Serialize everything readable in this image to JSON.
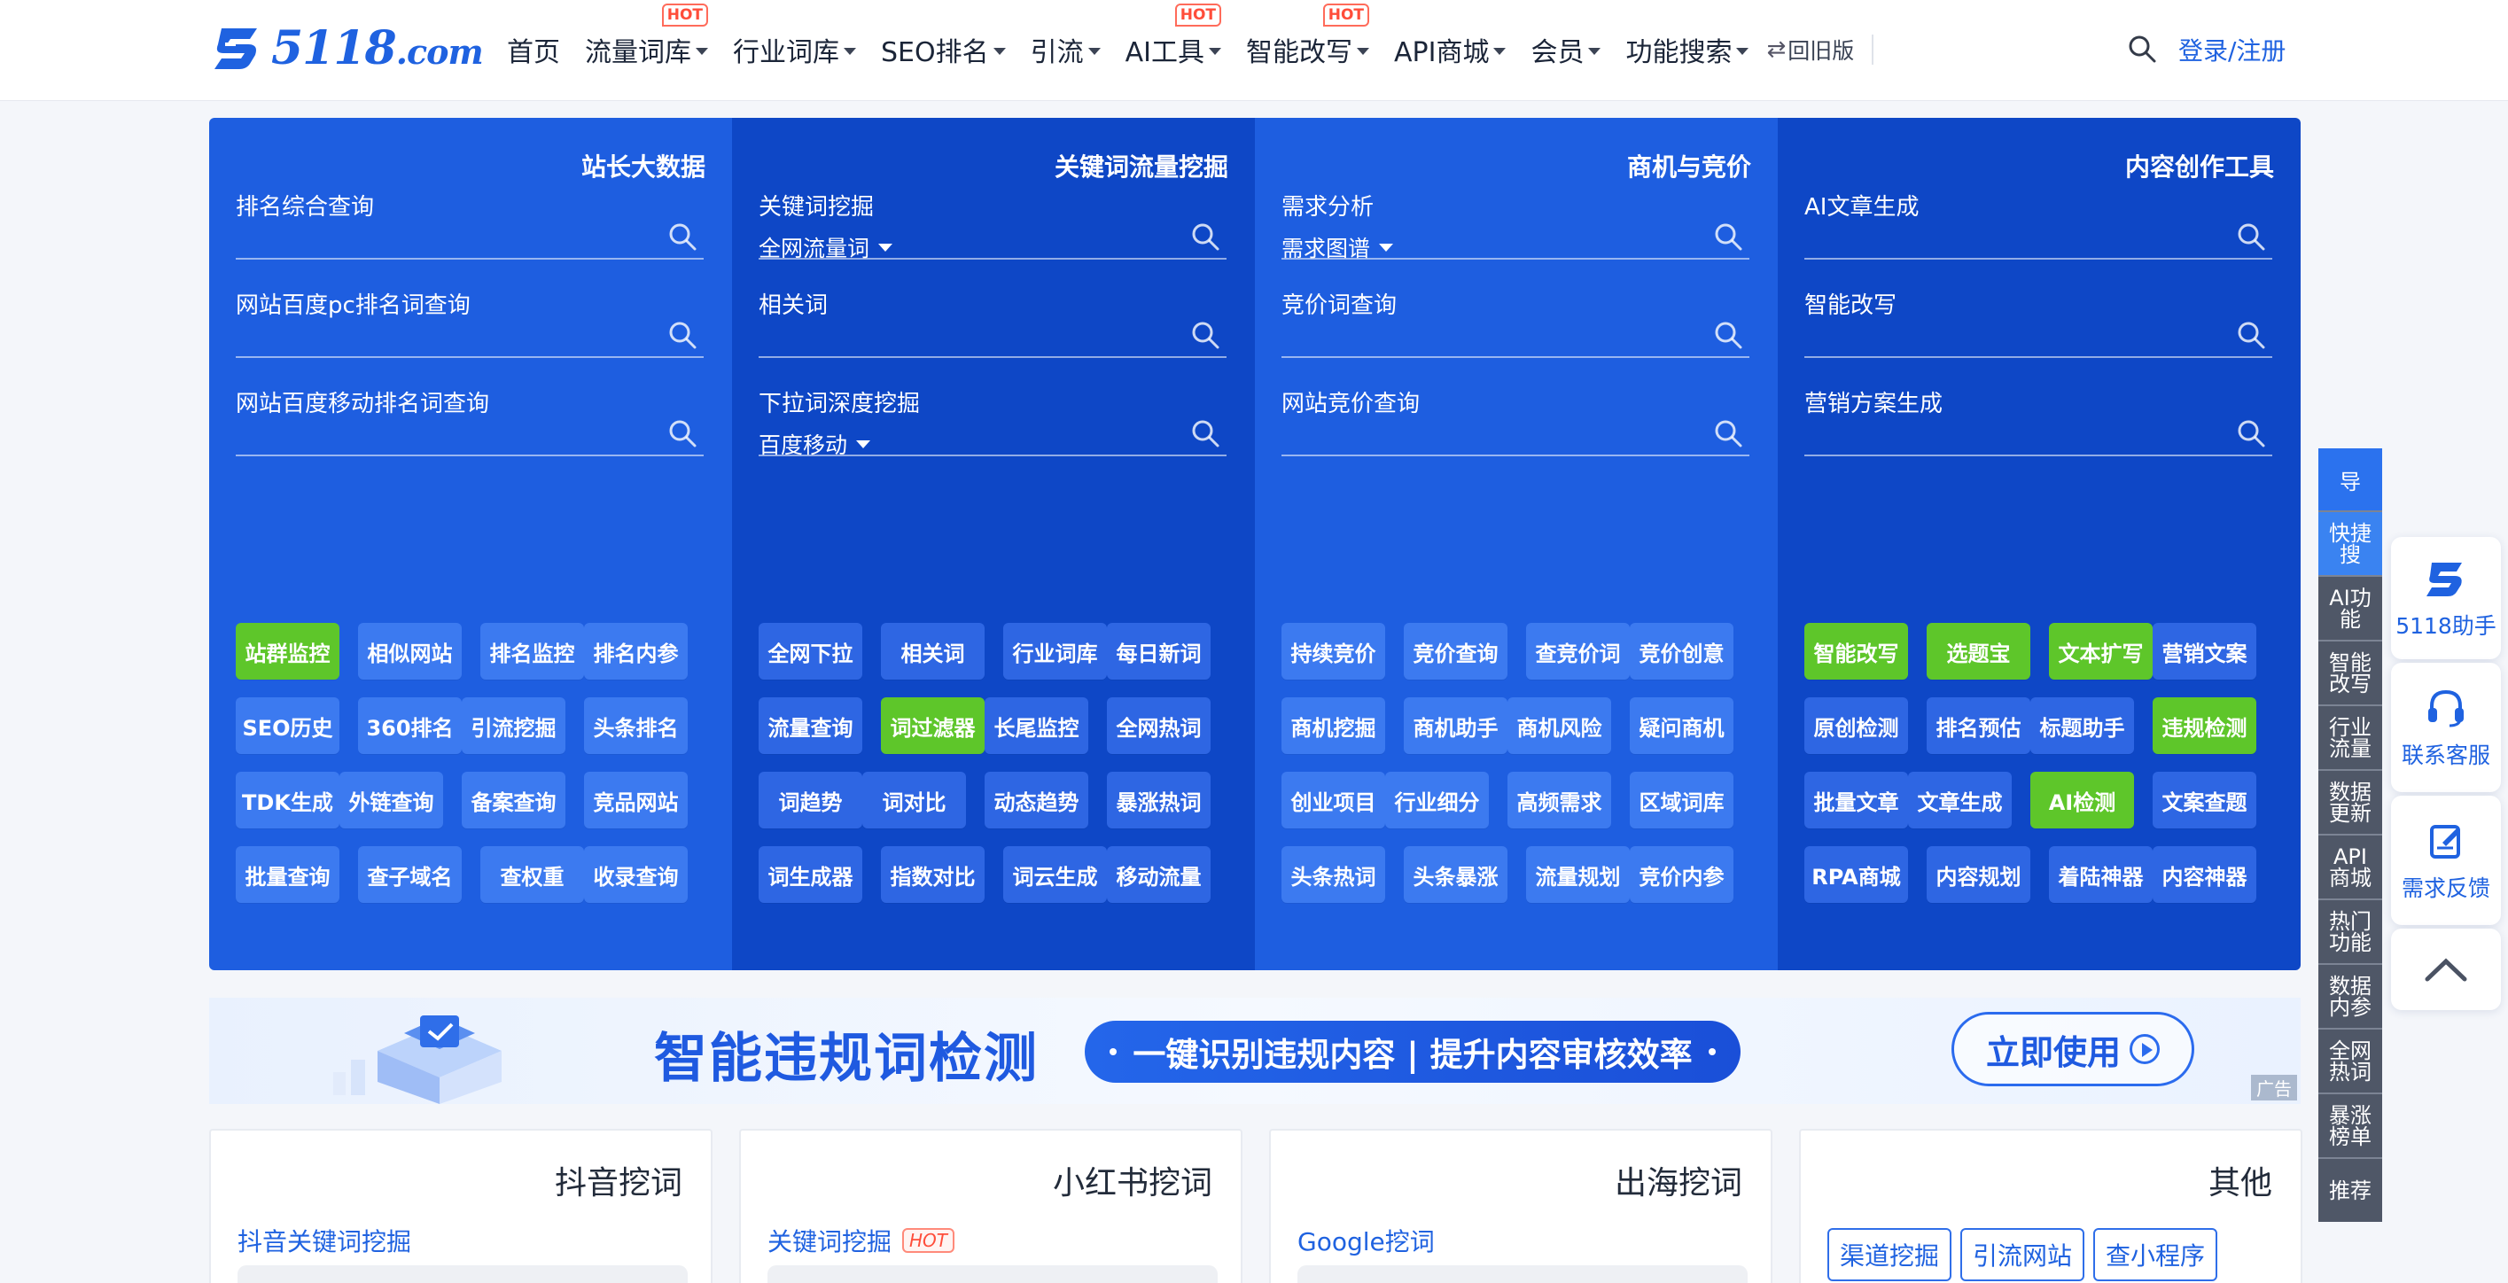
{
  "header": {
    "logo_text": "5118",
    "logo_suffix": ".com",
    "nav": [
      {
        "label": "首页",
        "dropdown": false,
        "hot": ""
      },
      {
        "label": "流量词库",
        "dropdown": true,
        "hot": "HOT"
      },
      {
        "label": "行业词库",
        "dropdown": true,
        "hot": ""
      },
      {
        "label": "SEO排名",
        "dropdown": true,
        "hot": ""
      },
      {
        "label": "引流",
        "dropdown": true,
        "hot": ""
      },
      {
        "label": "AI工具",
        "dropdown": true,
        "hot": "HOT"
      },
      {
        "label": "智能改写",
        "dropdown": true,
        "hot": "HOT"
      },
      {
        "label": "API商城",
        "dropdown": true,
        "hot": ""
      },
      {
        "label": "会员",
        "dropdown": true,
        "hot": ""
      },
      {
        "label": "功能搜索",
        "dropdown": true,
        "hot": ""
      }
    ],
    "old_version": "回旧版",
    "login": "登录/注册"
  },
  "panel": {
    "columns": [
      {
        "title": "站长大数据",
        "queries": [
          {
            "label": "排名综合查询",
            "sub": ""
          },
          {
            "label": "网站百度pc排名词查询",
            "sub": ""
          },
          {
            "label": "网站百度移动排名词查询",
            "sub": ""
          }
        ],
        "buttons": [
          {
            "label": "站群监控",
            "green": true
          },
          {
            "label": "相似网站",
            "green": false
          },
          {
            "label": "排名监控",
            "green": false
          },
          {
            "label": "排名内参",
            "green": false
          },
          {
            "label": "SEO历史",
            "green": false
          },
          {
            "label": "360排名",
            "green": false
          },
          {
            "label": "引流挖掘",
            "green": false
          },
          {
            "label": "头条排名",
            "green": false
          },
          {
            "label": "TDK生成",
            "green": false
          },
          {
            "label": "外链查询",
            "green": false
          },
          {
            "label": "备案查询",
            "green": false
          },
          {
            "label": "竞品网站",
            "green": false
          },
          {
            "label": "批量查询",
            "green": false
          },
          {
            "label": "查子域名",
            "green": false
          },
          {
            "label": "查权重",
            "green": false
          },
          {
            "label": "收录查询",
            "green": false
          }
        ]
      },
      {
        "title": "关键词流量挖掘",
        "queries": [
          {
            "label": "关键词挖掘",
            "sub": "全网流量词"
          },
          {
            "label": "相关词",
            "sub": ""
          },
          {
            "label": "下拉词深度挖掘",
            "sub": "百度移动"
          }
        ],
        "buttons": [
          {
            "label": "全网下拉",
            "green": false
          },
          {
            "label": "相关词",
            "green": false
          },
          {
            "label": "行业词库",
            "green": false
          },
          {
            "label": "每日新词",
            "green": false
          },
          {
            "label": "流量查询",
            "green": false
          },
          {
            "label": "词过滤器",
            "green": true
          },
          {
            "label": "长尾监控",
            "green": false
          },
          {
            "label": "全网热词",
            "green": false
          },
          {
            "label": "词趋势",
            "green": false
          },
          {
            "label": "词对比",
            "green": false
          },
          {
            "label": "动态趋势",
            "green": false
          },
          {
            "label": "暴涨热词",
            "green": false
          },
          {
            "label": "词生成器",
            "green": false
          },
          {
            "label": "指数对比",
            "green": false
          },
          {
            "label": "词云生成",
            "green": false
          },
          {
            "label": "移动流量",
            "green": false
          }
        ]
      },
      {
        "title": "商机与竞价",
        "queries": [
          {
            "label": "需求分析",
            "sub": "需求图谱"
          },
          {
            "label": "竞价词查询",
            "sub": ""
          },
          {
            "label": "网站竞价查询",
            "sub": ""
          }
        ],
        "buttons": [
          {
            "label": "持续竞价",
            "green": false
          },
          {
            "label": "竞价查询",
            "green": false
          },
          {
            "label": "查竞价词",
            "green": false
          },
          {
            "label": "竞价创意",
            "green": false
          },
          {
            "label": "商机挖掘",
            "green": false
          },
          {
            "label": "商机助手",
            "green": false
          },
          {
            "label": "商机风险",
            "green": false
          },
          {
            "label": "疑问商机",
            "green": false
          },
          {
            "label": "创业项目",
            "green": false
          },
          {
            "label": "行业细分",
            "green": false
          },
          {
            "label": "高频需求",
            "green": false
          },
          {
            "label": "区域词库",
            "green": false
          },
          {
            "label": "头条热词",
            "green": false
          },
          {
            "label": "头条暴涨",
            "green": false
          },
          {
            "label": "流量规划",
            "green": false
          },
          {
            "label": "竞价内参",
            "green": false
          }
        ]
      },
      {
        "title": "内容创作工具",
        "queries": [
          {
            "label": "AI文章生成",
            "sub": ""
          },
          {
            "label": "智能改写",
            "sub": ""
          },
          {
            "label": "营销方案生成",
            "sub": ""
          }
        ],
        "buttons": [
          {
            "label": "智能改写",
            "green": true
          },
          {
            "label": "选题宝",
            "green": true
          },
          {
            "label": "文本扩写",
            "green": true
          },
          {
            "label": "营销文案",
            "green": false
          },
          {
            "label": "原创检测",
            "green": false
          },
          {
            "label": "排名预估",
            "green": false
          },
          {
            "label": "标题助手",
            "green": false
          },
          {
            "label": "违规检测",
            "green": true
          },
          {
            "label": "批量文章",
            "green": false
          },
          {
            "label": "文章生成",
            "green": false
          },
          {
            "label": "AI检测",
            "green": true
          },
          {
            "label": "文案查题",
            "green": false
          },
          {
            "label": "RPA商城",
            "green": false
          },
          {
            "label": "内容规划",
            "green": false
          },
          {
            "label": "着陆神器",
            "green": false
          },
          {
            "label": "内容神器",
            "green": false
          }
        ]
      }
    ]
  },
  "banner": {
    "title": "智能违规词检测",
    "pill": "一键识别违规内容 | 提升内容审核效率",
    "cta": "立即使用",
    "ad": "广告"
  },
  "cards": [
    {
      "title": "抖音挖词",
      "link": "抖音关键词挖掘",
      "hot": ""
    },
    {
      "title": "小红书挖词",
      "link": "关键词挖掘",
      "hot": "HOT"
    },
    {
      "title": "出海挖词",
      "link": "Google挖词",
      "hot": ""
    },
    {
      "title": "其他",
      "chips": [
        "渠道挖掘",
        "引流网站",
        "查小程序"
      ]
    }
  ],
  "side_nav": {
    "top": "导",
    "items": [
      "快捷搜",
      "AI功能",
      "智能改写",
      "行业流量",
      "数据更新",
      "API商城",
      "热门功能",
      "数据内参",
      "全网热词",
      "暴涨榜单",
      "推荐"
    ]
  },
  "float": {
    "assistant": "5118助手",
    "service": "联系客服",
    "feedback": "需求反馈"
  },
  "colors": {
    "brand": "#1f62e0",
    "panel_light": "#1e5ee0",
    "panel_dark": "#0e47c6",
    "green": "#5ec62a",
    "hot": "#ff4d3a"
  }
}
